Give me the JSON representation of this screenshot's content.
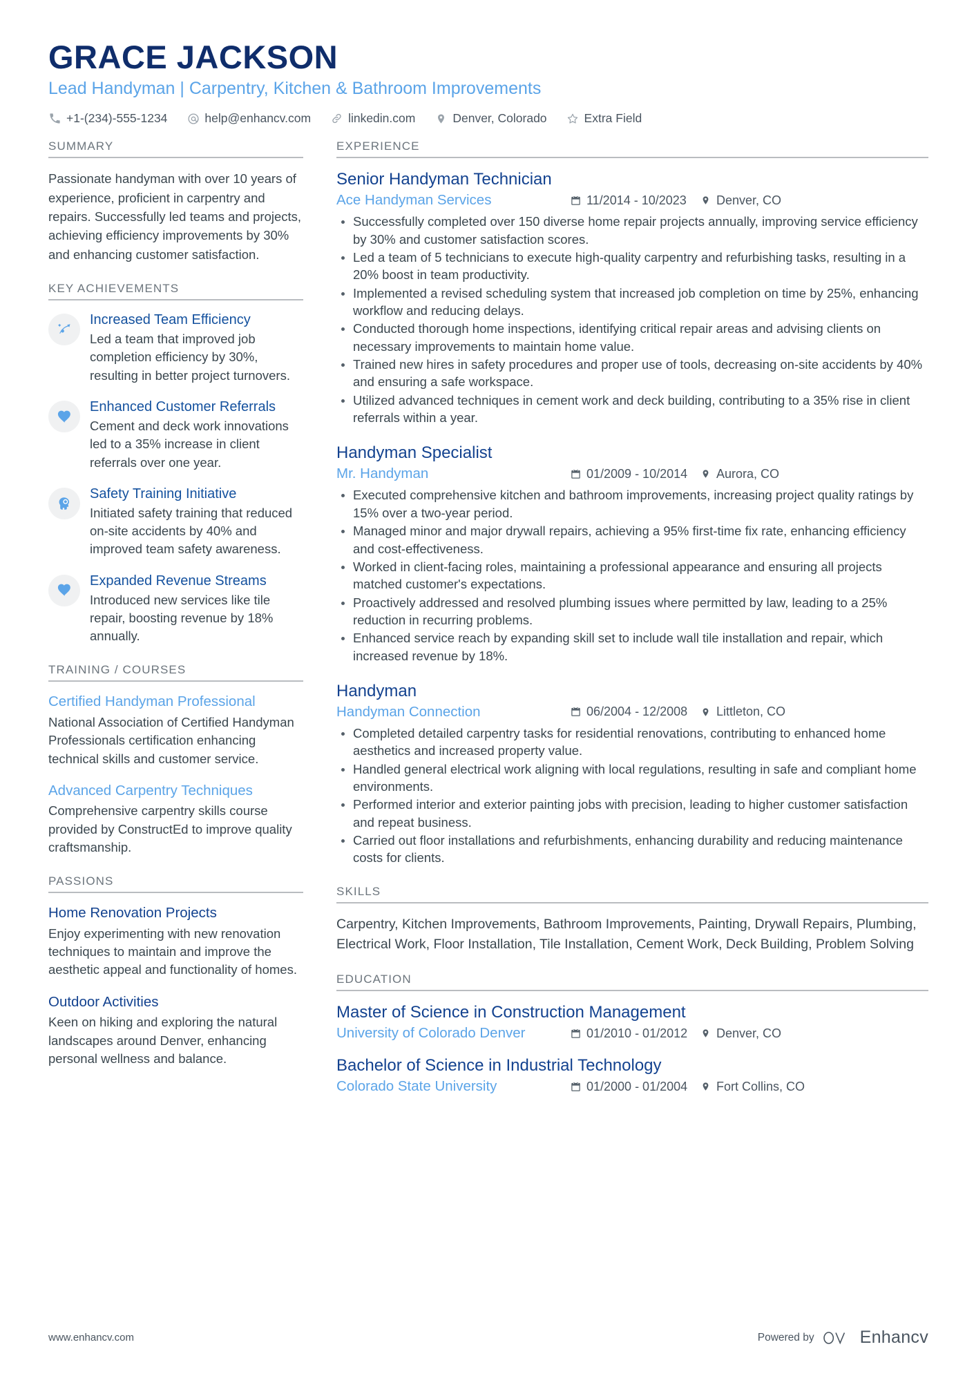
{
  "colors": {
    "name_navy": "#0f2d6b",
    "heading_navy": "#13428f",
    "accent_light_blue": "#5ba4e8",
    "body_gray": "#3b474f",
    "section_label_gray": "#6c757d",
    "rule_gray": "#b9bcc0",
    "badge_bg": "#f0f1f2"
  },
  "header": {
    "name": "GRACE JACKSON",
    "headline": "Lead Handyman | Carpentry, Kitchen & Bathroom Improvements",
    "contacts": [
      {
        "icon": "phone-icon",
        "text": "+1-(234)-555-1234"
      },
      {
        "icon": "email-icon",
        "text": "help@enhancv.com"
      },
      {
        "icon": "link-icon",
        "text": "linkedin.com"
      },
      {
        "icon": "location-pin-icon",
        "text": "Denver, Colorado"
      },
      {
        "icon": "star-icon",
        "text": "Extra Field"
      }
    ]
  },
  "left": {
    "summary": {
      "title": "SUMMARY",
      "text": "Passionate handyman with over 10 years of experience, proficient in carpentry and repairs. Successfully led teams and projects, achieving efficiency improvements by 30% and enhancing customer satisfaction."
    },
    "key_achievements": {
      "title": "KEY ACHIEVEMENTS",
      "items": [
        {
          "icon": "trend-arrow-icon",
          "title": "Increased Team Efficiency",
          "desc": "Led a team that improved job completion efficiency by 30%, resulting in better project turnovers."
        },
        {
          "icon": "heart-icon",
          "title": "Enhanced Customer Referrals",
          "desc": "Cement and deck work innovations led to a 35% increase in client referrals over one year."
        },
        {
          "icon": "head-idea-icon",
          "title": "Safety Training Initiative",
          "desc": "Initiated safety training that reduced on-site accidents by 40% and improved team safety awareness."
        },
        {
          "icon": "heart-icon",
          "title": "Expanded Revenue Streams",
          "desc": "Introduced new services like tile repair, boosting revenue by 18% annually."
        }
      ]
    },
    "training": {
      "title": "TRAINING / COURSES",
      "items": [
        {
          "title": "Certified Handyman Professional",
          "desc": "National Association of Certified Handyman Professionals certification enhancing technical skills and customer service."
        },
        {
          "title": "Advanced Carpentry Techniques",
          "desc": "Comprehensive carpentry skills course provided by ConstructEd to improve quality craftsmanship."
        }
      ]
    },
    "passions": {
      "title": "PASSIONS",
      "items": [
        {
          "title": "Home Renovation Projects",
          "desc": "Enjoy experimenting with new renovation techniques to maintain and improve the aesthetic appeal and functionality of homes."
        },
        {
          "title": "Outdoor Activities",
          "desc": "Keen on hiking and exploring the natural landscapes around Denver, enhancing personal wellness and balance."
        }
      ]
    }
  },
  "right": {
    "experience": {
      "title": "EXPERIENCE",
      "jobs": [
        {
          "title": "Senior Handyman Technician",
          "company": "Ace Handyman Services",
          "dates": "11/2014 - 10/2023",
          "location": "Denver, CO",
          "bullets": [
            "Successfully completed over 150 diverse home repair projects annually, improving service efficiency by 30% and customer satisfaction scores.",
            "Led a team of 5 technicians to execute high-quality carpentry and refurbishing tasks, resulting in a 20% boost in team productivity.",
            "Implemented a revised scheduling system that increased job completion on time by 25%, enhancing workflow and reducing delays.",
            "Conducted thorough home inspections, identifying critical repair areas and advising clients on necessary improvements to maintain home value.",
            "Trained new hires in safety procedures and proper use of tools, decreasing on-site accidents by 40% and ensuring a safe workspace.",
            "Utilized advanced techniques in cement work and deck building, contributing to a 35% rise in client referrals within a year."
          ]
        },
        {
          "title": "Handyman Specialist",
          "company": "Mr. Handyman",
          "dates": "01/2009 - 10/2014",
          "location": "Aurora, CO",
          "bullets": [
            "Executed comprehensive kitchen and bathroom improvements, increasing project quality ratings by 15% over a two-year period.",
            "Managed minor and major drywall repairs, achieving a 95% first-time fix rate, enhancing efficiency and cost-effectiveness.",
            "Worked in client-facing roles, maintaining a professional appearance and ensuring all projects matched customer's expectations.",
            "Proactively addressed and resolved plumbing issues where permitted by law, leading to a 25% reduction in recurring problems.",
            "Enhanced service reach by expanding skill set to include wall tile installation and repair, which increased revenue by 18%."
          ]
        },
        {
          "title": "Handyman",
          "company": "Handyman Connection",
          "dates": "06/2004 - 12/2008",
          "location": "Littleton, CO",
          "bullets": [
            "Completed detailed carpentry tasks for residential renovations, contributing to enhanced home aesthetics and increased property value.",
            "Handled general electrical work aligning with local regulations, resulting in safe and compliant home environments.",
            "Performed interior and exterior painting jobs with precision, leading to higher customer satisfaction and repeat business.",
            "Carried out floor installations and refurbishments, enhancing durability and reducing maintenance costs for clients."
          ]
        }
      ]
    },
    "skills": {
      "title": "SKILLS",
      "text": "Carpentry, Kitchen Improvements, Bathroom Improvements, Painting, Drywall Repairs, Plumbing, Electrical Work, Floor Installation, Tile Installation, Cement Work, Deck Building, Problem Solving"
    },
    "education": {
      "title": "EDUCATION",
      "items": [
        {
          "degree": "Master of Science in Construction Management",
          "school": "University of Colorado Denver",
          "dates": "01/2010 - 01/2012",
          "location": "Denver, CO"
        },
        {
          "degree": "Bachelor of Science in Industrial Technology",
          "school": "Colorado State University",
          "dates": "01/2000 - 01/2004",
          "location": "Fort Collins, CO"
        }
      ]
    }
  },
  "footer": {
    "url": "www.enhancv.com",
    "powered_by": "Powered by",
    "brand": "Enhancv"
  }
}
